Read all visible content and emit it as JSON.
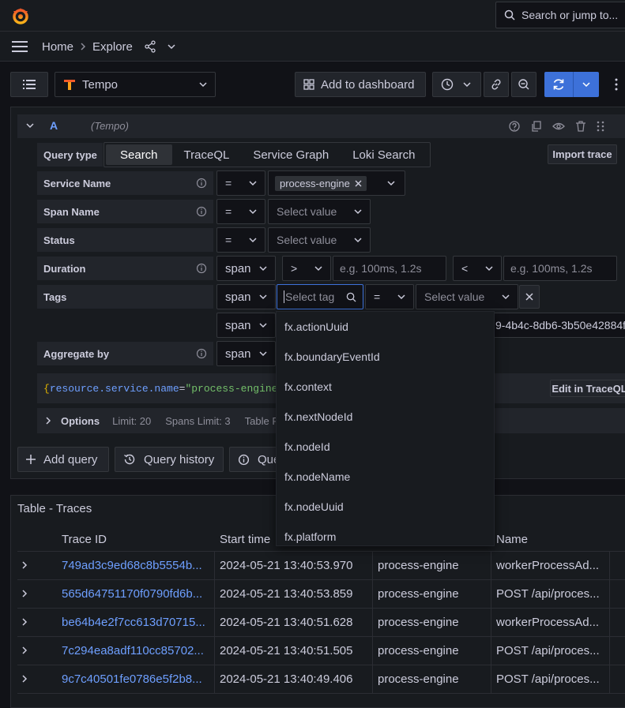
{
  "topbar": {
    "search_placeholder": "Search or jump to..."
  },
  "breadcrumb": {
    "home": "Home",
    "explore": "Explore"
  },
  "toolbar": {
    "datasource": "Tempo",
    "add_to_dashboard": "Add to dashboard"
  },
  "query": {
    "letter": "A",
    "datasource_hint": "(Tempo)",
    "query_type_label": "Query type",
    "tabs": [
      "Search",
      "TraceQL",
      "Service Graph",
      "Loki Search"
    ],
    "import_trace": "Import trace",
    "fields": {
      "service_name": "Service Name",
      "span_name": "Span Name",
      "status": "Status",
      "duration": "Duration",
      "tags": "Tags",
      "aggregate_by": "Aggregate by"
    },
    "operators": {
      "eq": "=",
      "gt": ">",
      "lt": "<"
    },
    "scope": "span",
    "service_value": "process-engine",
    "select_value": "Select value",
    "duration_placeholder": "e.g. 100ms, 1.2s",
    "select_tag": "Select tag",
    "truncated_tag_value": "9-4b4c-8db6-3b50e42884f",
    "traceql_open": "{",
    "traceql_attr": "resource.service.name",
    "traceql_eq": "=",
    "traceql_value": "\"process-engine\"",
    "traceql_close": "}",
    "edit_in_traceql": "Edit in TraceQL",
    "options": {
      "label": "Options",
      "limit": "Limit: 20",
      "spans_limit": "Spans Limit: 3",
      "table_format": "Table Fo"
    }
  },
  "tag_dropdown": [
    "fx.actionUuid",
    "fx.boundaryEventId",
    "fx.context",
    "fx.nextNodeId",
    "fx.nodeId",
    "fx.nodeName",
    "fx.nodeUuid",
    "fx.platform"
  ],
  "actions": {
    "add_query": "Add query",
    "query_history": "Query history",
    "query_inspector": "Que"
  },
  "results": {
    "title": "Table - Traces",
    "columns": [
      "Trace ID",
      "Start time",
      "",
      "Name"
    ],
    "rows": [
      {
        "trace_id": "749ad3c9ed68c8b5554b...",
        "start": "2024-05-21 13:40:53.970",
        "service": "process-engine",
        "name": "workerProcessAd..."
      },
      {
        "trace_id": "565d64751170f0790fd6b...",
        "start": "2024-05-21 13:40:53.859",
        "service": "process-engine",
        "name": "POST /api/proces..."
      },
      {
        "trace_id": "be64b4e2f7cc613d70715...",
        "start": "2024-05-21 13:40:51.628",
        "service": "process-engine",
        "name": "workerProcessAd..."
      },
      {
        "trace_id": "7c294ea8adf110cc85702...",
        "start": "2024-05-21 13:40:51.505",
        "service": "process-engine",
        "name": "POST /api/proces..."
      },
      {
        "trace_id": "9c7c40501fe0786e5f2b8...",
        "start": "2024-05-21 13:40:49.406",
        "service": "process-engine",
        "name": "POST /api/proces..."
      }
    ]
  },
  "colors": {
    "accent": "#3d71d9",
    "link": "#6e9fff",
    "background": "#111217",
    "panel": "#181b1f"
  }
}
